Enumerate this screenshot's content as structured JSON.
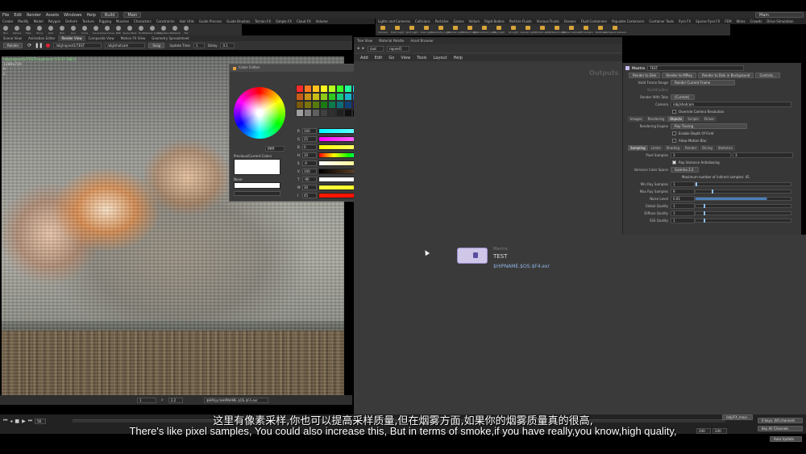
{
  "menubar": {
    "items": [
      "File",
      "Edit",
      "Render",
      "Assets",
      "Windows",
      "Help"
    ],
    "desktop": "Build",
    "context": "Main",
    "right_desktop": "Main"
  },
  "shelf": {
    "tabs": [
      "Create",
      "Modify",
      "Model",
      "Polygon",
      "Deform",
      "Texture",
      "Rigging",
      "Muscles",
      "Characters",
      "Constraints",
      "Hair Utils",
      "Guide Process",
      "Guide Brushes",
      "Terrain FX",
      "Simple FX",
      "Cloud FX",
      "Volume"
    ],
    "tools": [
      "Box",
      "Sphere",
      "Tube",
      "Torus",
      "Grid",
      "Null",
      "Line",
      "Circle",
      "Curve",
      "Draw Curve",
      "Path",
      "Spray Paint",
      "Font",
      "Platonic Solids",
      "L-System",
      "Metaball",
      "File"
    ],
    "right_tabs": [
      "Lights and Cameras",
      "Collisions",
      "Particles",
      "Grains",
      "Vellum",
      "Rigid Bodies",
      "Particle Fluids",
      "Viscous Fluids",
      "Oceans",
      "Fluid Containers",
      "Populate Containers",
      "Container Tools",
      "Pyro FX",
      "Sparse Pyro FX",
      "FEM",
      "Wires",
      "Crowds",
      "Drive Simulation"
    ],
    "right_tools": [
      "Camera",
      "Point Light",
      "Spot Light",
      "Area Light",
      "Geometry Light",
      "Volume Light",
      "Distant Light",
      "Environment Light",
      "Sky Light",
      "GI Light",
      "Caustic Light",
      "Portal Light",
      "Ambient Light",
      "Stereo Camera",
      "VR Camera",
      "Switcher",
      "Gamepad Camera"
    ]
  },
  "left_pane": {
    "tabs": [
      "Scene View",
      "Animation Editor",
      "Render View",
      "Composite View",
      "Motion FX View",
      "Geometry Spreadsheet"
    ],
    "active_tab": "Render View",
    "render_button": "Render",
    "camera_path": "/obj/ropnet1/TEST",
    "camera2": "/obj/shotcam",
    "snap_label": "Snap",
    "update_time_label": "Update Time",
    "update_time_value": "1",
    "delay_label": "Delay",
    "delay_value": "0.1",
    "info_lines": [
      "/obj/ropnet1/TEST(raytrace)  13:37:38[1]",
      "1280x720",
      "R",
      "C"
    ],
    "bottom_value": "1",
    "zoom_value": "2.2",
    "bottom_path": "$HIP/ipr/$HIPNAME.$OS.$F4.exr"
  },
  "color_editor": {
    "title": "Color Editor",
    "color_value": "ffffff",
    "prev_current_label": "Previous/Current Colors",
    "none_label": "None",
    "sliders": [
      {
        "label": "R",
        "value": "100"
      },
      {
        "label": "G",
        "value": "25"
      },
      {
        "label": "B",
        "value": "0"
      },
      {
        "label": "H",
        "value": "10"
      },
      {
        "label": "S",
        "value": ".9"
      },
      {
        "label": "V",
        "value": "100"
      },
      {
        "label": "T",
        "value": "-90"
      },
      {
        "label": "M",
        "value": "30"
      },
      {
        "label": "I",
        "value": "45"
      }
    ],
    "palette": [
      "#ff2a2a",
      "#ff7a1f",
      "#ffc21f",
      "#fff21f",
      "#b6ff1f",
      "#3bff2a",
      "#1fff9a",
      "#1fe6ff",
      "#1f8bff",
      "#3b2aff",
      "#a81fff",
      "#ff1fd4",
      "#ff1f74",
      "#c81e1e",
      "#c85c17",
      "#c89317",
      "#c8bd17",
      "#8ec817",
      "#2ec81e",
      "#17c878",
      "#17b3c8",
      "#176cc8",
      "#2e1ec8",
      "#8317c8",
      "#c817a5",
      "#c8175a",
      "#7a1414",
      "#7a380f",
      "#7a5a0f",
      "#7a730f",
      "#577a0f",
      "#1c7a14",
      "#0f7a49",
      "#0f6d7a",
      "#0f427a",
      "#1c147a",
      "#500f7a",
      "#7a0f65",
      "#7a0f37",
      "#ffffff",
      "#e0e0e0",
      "#c0c0c0",
      "#a0a0a0",
      "#808080",
      "#606060",
      "#404040",
      "#303030",
      "#202020",
      "#101010",
      "#000000",
      "#555555",
      "#999999"
    ]
  },
  "network": {
    "tabs": [
      "Tree View",
      "Material Palette",
      "Asset Browser"
    ],
    "path": "/out",
    "path2": "ropnet1",
    "menu": [
      "Add",
      "Edit",
      "Go",
      "View",
      "Tools",
      "Layout",
      "Help"
    ],
    "outputs_label": "Outputs",
    "node": {
      "type": "Mantra",
      "name": "TEST",
      "output": "$HIPNAME.$OS.$F4.exr"
    }
  },
  "params": {
    "header_type": "Mantra",
    "header_name": "TEST",
    "buttons": [
      "Render to Disk",
      "Render to MPlay",
      "Render to Disk in Background",
      "Controls..."
    ],
    "valid_frame_label": "Valid Frame Range",
    "valid_frame_value": "Render Current Frame",
    "start_end_label": "Start/End/Inc",
    "render_with_take_label": "Render With Take",
    "render_with_take_value": "(Current)",
    "camera_label": "Camera",
    "camera_value": "/obj/shotcam",
    "override_label": "Override Camera Resolution",
    "main_tabs": [
      "Images",
      "Rendering",
      "Objects",
      "Scripts",
      "Driver"
    ],
    "engine_label": "Rendering Engine",
    "engine_value": "Ray Tracing",
    "dof_label": "Enable Depth Of Field",
    "motion_blur_label": "Allow Motion Blur",
    "sub_tabs": [
      "Sampling",
      "Limits",
      "Shading",
      "Render",
      "Dicing",
      "Statistics"
    ],
    "pixel_samples_label": "Pixel Samples",
    "pixel_samples_x": "3",
    "pixel_samples_y": "3",
    "ray_variance_label": "Ray Variance Antialiasing",
    "variance_color_label": "Variance Color Space",
    "variance_color_value": "Gamma 2.2",
    "max_indirect_label": "Maximum number of indirect samples: 45",
    "min_ray_label": "Min Ray Samples",
    "min_ray_value": "1",
    "max_ray_label": "Max Ray Samples",
    "max_ray_value": "9",
    "noise_label": "Noise Level",
    "noise_value": "0.01",
    "global_q_label": "Global Quality",
    "global_q_value": "1",
    "diffuse_q_label": "Diffuse Quality",
    "diffuse_q_value": "1",
    "sss_q_label": "SSS Quality",
    "sss_q_value": "1"
  },
  "timeline": {
    "frame": "56",
    "end": "240",
    "end2": "240",
    "keys_label": "0 keys, 0/0 channels",
    "all_channels": "Key All Channels",
    "auto_update": "Auto Update",
    "right_path": "/obj/FX_mov/..."
  },
  "subtitles": {
    "cn": "这里有像素采样,你也可以提高采样质量,但在烟雾方面,如果你的烟雾质量真的很高,",
    "en": "There's like pixel samples, You could also increase this, But in terms of smoke,if you have really,you know,high quality,"
  }
}
